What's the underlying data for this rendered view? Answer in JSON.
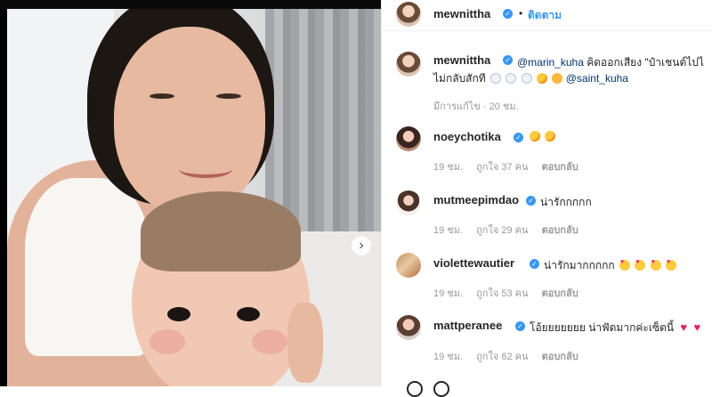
{
  "photo": {
    "next_icon": "chevron-right-icon",
    "next_glyph": "›"
  },
  "header": {
    "username": "mewnittha",
    "separator": "•",
    "follow_label": "ติดตาม"
  },
  "caption": {
    "username": "mewnittha",
    "mention1": "@marin_kuha",
    "text1": "คิดออกเสียง \"ป๋าเชนต์ไปไ",
    "text2": "ไม่กลับสักที",
    "mention2": "@saint_kuha",
    "meta": "มีการแก้ไข · 20 ชม."
  },
  "comments": [
    {
      "username": "noeychotika",
      "text": "",
      "emojis": [
        "kissing-heart",
        "kissing-heart"
      ],
      "time": "19 ชม.",
      "likes": "ถูกใจ 37 คน",
      "reply": "ตอบกลับ"
    },
    {
      "username": "mutmeepimdao",
      "text": "น่ารักกกกก",
      "emojis": [],
      "time": "19 ชม.",
      "likes": "ถูกใจ 29 คน",
      "reply": "ตอบกลับ"
    },
    {
      "username": "violettewautier",
      "text": "น่ารักมากกกกก",
      "emojis": [
        "heart-eyes",
        "heart-eyes",
        "heart-eyes",
        "heart-eyes"
      ],
      "time": "19 ชม.",
      "likes": "ถูกใจ 53 คน",
      "reply": "ตอบกลับ"
    },
    {
      "username": "mattperanee",
      "text": "โอ้ยยยยยยย น่าฟัดมากค่ะเซ็ตนี้",
      "emojis": [
        "red-heart",
        "red-heart"
      ],
      "time": "19 ชม.",
      "likes": "ถูกใจ 62 คน",
      "reply": "ตอบกลับ"
    }
  ],
  "colors": {
    "link": "#3897f0",
    "verified": "#3897f0",
    "mention": "#003569",
    "meta": "#999999"
  }
}
